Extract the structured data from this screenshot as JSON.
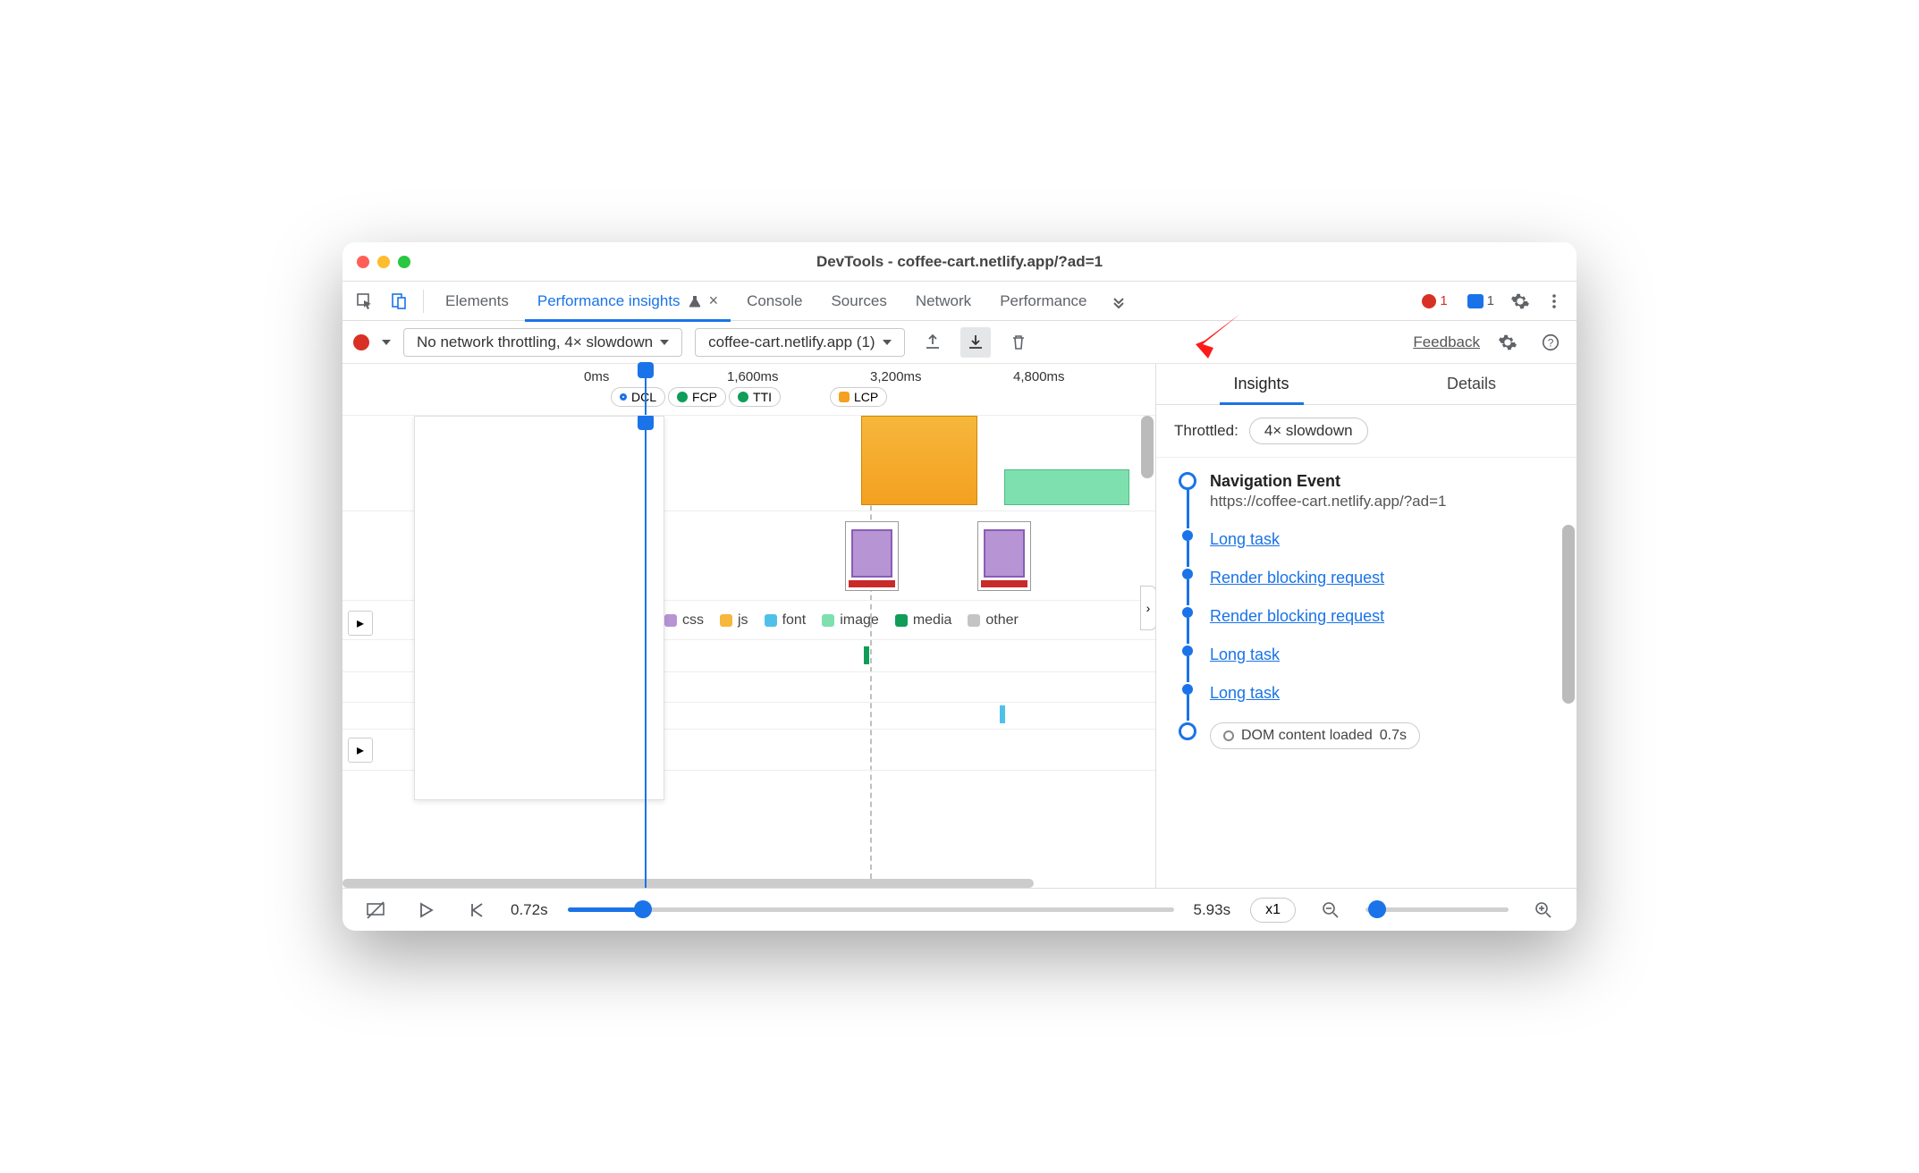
{
  "window": {
    "title": "DevTools - coffee-cart.netlify.app/?ad=1"
  },
  "tabs": {
    "elements": "Elements",
    "perf_insights": "Performance insights",
    "console": "Console",
    "sources": "Sources",
    "network": "Network",
    "performance": "Performance"
  },
  "badges": {
    "errors": "1",
    "messages": "1"
  },
  "toolbar": {
    "throttle_select": "No network throttling, 4× slowdown",
    "recording_select": "coffee-cart.netlify.app (1)",
    "feedback": "Feedback"
  },
  "timeline": {
    "ticks": [
      "0ms",
      "1,600ms",
      "3,200ms",
      "4,800ms"
    ],
    "markers": [
      {
        "label": "DCL",
        "color": "#1a73e8",
        "ring": true
      },
      {
        "label": "FCP",
        "color": "#0f9d58"
      },
      {
        "label": "TTI",
        "color": "#0f9d58"
      },
      {
        "label": "LCP",
        "color": "#f4a020"
      }
    ],
    "legend": [
      {
        "label": "css",
        "color": "#b794d4"
      },
      {
        "label": "js",
        "color": "#f6b73c"
      },
      {
        "label": "font",
        "color": "#4fc1e9"
      },
      {
        "label": "image",
        "color": "#7fe0af"
      },
      {
        "label": "media",
        "color": "#0f9d58"
      },
      {
        "label": "other",
        "color": "#c4c4c4"
      }
    ]
  },
  "right": {
    "tabs": {
      "insights": "Insights",
      "details": "Details"
    },
    "throttled_label": "Throttled:",
    "throttled_value": "4× slowdown",
    "nav_event_title": "Navigation Event",
    "nav_event_url": "https://coffee-cart.netlify.app/?ad=1",
    "items": [
      "Long task",
      "Render blocking request",
      "Render blocking request",
      "Long task",
      "Long task"
    ],
    "dom_loaded": "DOM content loaded",
    "dom_loaded_time": "0.7s"
  },
  "footer": {
    "start_time": "0.72s",
    "end_time": "5.93s",
    "speed": "x1"
  },
  "colors": {
    "accent": "#1a73e8"
  }
}
